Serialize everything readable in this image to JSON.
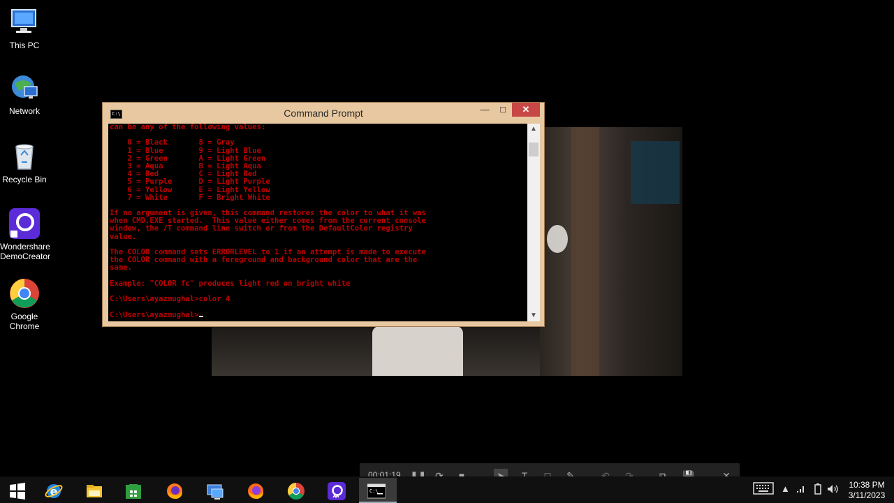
{
  "desktop": {
    "icons": [
      {
        "label": "This PC"
      },
      {
        "label": "Network"
      },
      {
        "label": "Recycle Bin"
      },
      {
        "label": "Wondershare\nDemoCreator"
      },
      {
        "label": "Google\nChrome"
      }
    ]
  },
  "cmd_window": {
    "title": "Command Prompt",
    "lines": [
      "can be any of the following values:",
      "",
      "    0 = Black       8 = Gray",
      "    1 = Blue        9 = Light Blue",
      "    2 = Green       A = Light Green",
      "    3 = Aqua        B = Light Aqua",
      "    4 = Red         C = Light Red",
      "    5 = Purple      D = Light Purple",
      "    6 = Yellow      E = Light Yellow",
      "    7 = White       F = Bright White",
      "",
      "If no argument is given, this command restores the color to what it was",
      "when CMD.EXE started.  This value either comes from the current console",
      "window, the /T command line switch or from the DefaultColor registry",
      "value.",
      "",
      "The COLOR command sets ERRORLEVEL to 1 if an attempt is made to execute",
      "the COLOR command with a foreground and background color that are the",
      "same.",
      "",
      "Example: \"COLOR fc\" produces light red on bright white",
      "",
      "C:\\Users\\ayazmughal>color 4",
      "",
      "C:\\Users\\ayazmughal>"
    ],
    "text_color": "#c00000",
    "title_bar_color": "#e8c8a0",
    "close_color": "#c74646"
  },
  "recorder": {
    "time": "00:01:19"
  },
  "taskbar": {
    "clock_time": "10:38 PM",
    "clock_date": "3/11/2023",
    "apps": [
      "start-icon",
      "internet-explorer-icon",
      "file-explorer-icon",
      "store-icon",
      "firefox-icon",
      "remote-desktop-icon",
      "firefox-icon",
      "chrome-icon",
      "democreator-icon",
      "command-prompt-icon"
    ]
  }
}
